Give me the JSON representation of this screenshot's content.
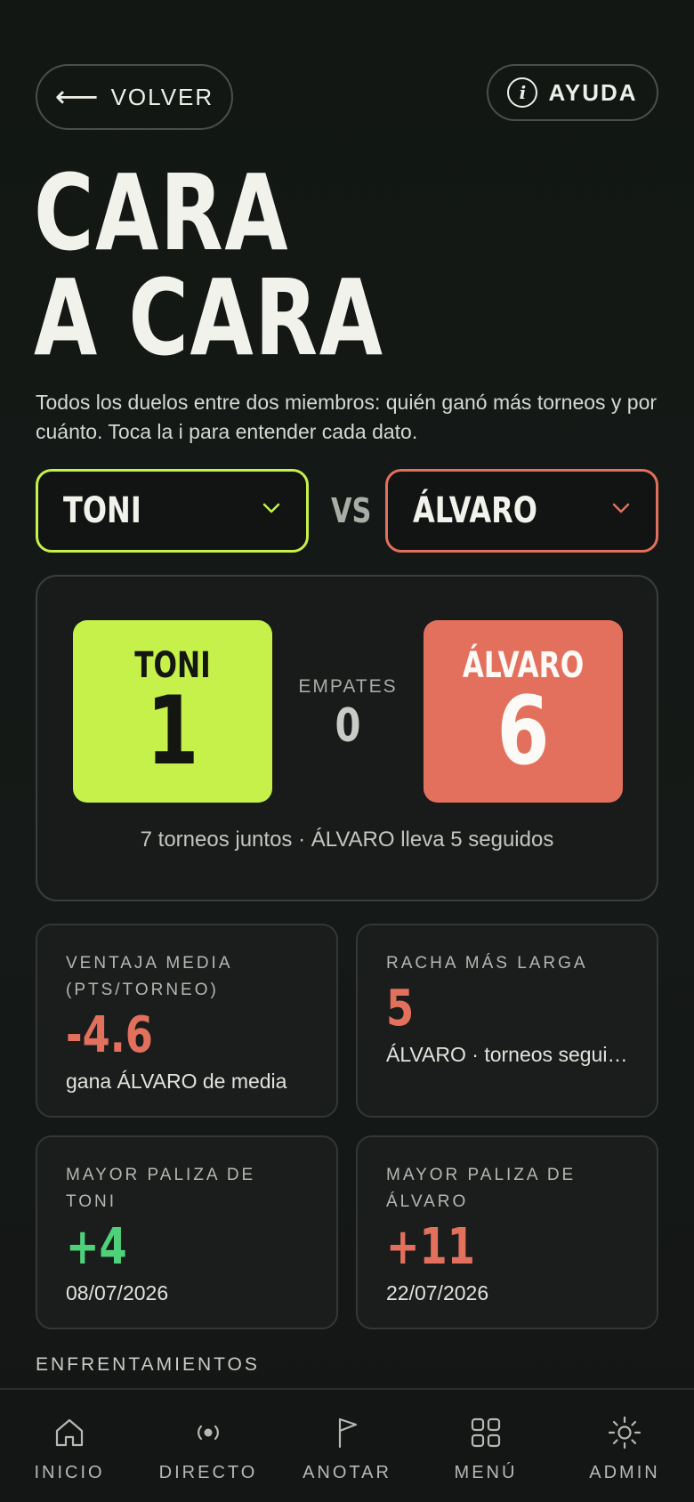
{
  "header": {
    "back_label": "VOLVER",
    "back_arrow": "⟵",
    "help_label": "AYUDA",
    "help_icon_glyph": "i"
  },
  "page": {
    "title_line1": "CARA",
    "title_line2": "A CARA",
    "subtitle": "Todos los duelos entre dos miembros: quién ganó más torneos y por cuánto. Toca la i para entender cada dato."
  },
  "selectors": {
    "player_a": "TONI",
    "vs_label": "VS",
    "player_b": "ÁLVARO",
    "chevron": "⌄"
  },
  "scoreboard": {
    "player_a_name": "TONI",
    "player_a_wins": "1",
    "draws_label": "EMPATES",
    "draws_value": "0",
    "player_b_name": "ÁLVARO",
    "player_b_wins": "6",
    "summary": "7 torneos juntos · ÁLVARO lleva 5 seguidos"
  },
  "stats": [
    {
      "label": "VENTAJA MEDIA (PTS/TORNEO)",
      "value": "-4.6",
      "note": "gana ÁLVARO de media"
    },
    {
      "label": "RACHA MÁS LARGA",
      "value": "5",
      "note": "ÁLVARO · torneos seguidos"
    },
    {
      "label": "MAYOR PALIZA DE TONI",
      "value": "+4",
      "note": "08/07/2026"
    },
    {
      "label": "MAYOR PALIZA DE ÁLVARO",
      "value": "+11",
      "note": "22/07/2026"
    }
  ],
  "section": {
    "matchups_label": "ENFRENTAMIENTOS"
  },
  "nav": [
    {
      "label": "INICIO",
      "icon": "home-icon"
    },
    {
      "label": "DIRECTO",
      "icon": "live-icon"
    },
    {
      "label": "ANOTAR",
      "icon": "flag-icon"
    },
    {
      "label": "MENÚ",
      "icon": "grid-icon"
    },
    {
      "label": "ADMIN",
      "icon": "sun-icon"
    }
  ],
  "colors": {
    "player_a": "#c6f04a",
    "player_b": "#e2705c",
    "positive": "#4fd07a",
    "background": "#131614"
  }
}
